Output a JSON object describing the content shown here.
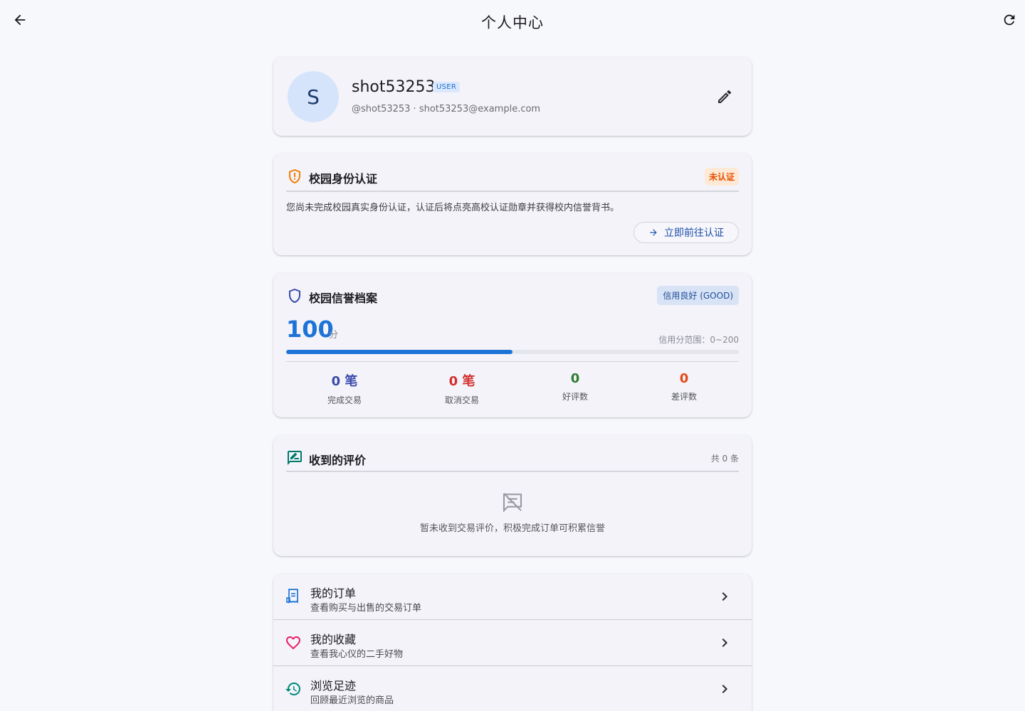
{
  "appbar": {
    "title": "个人中心",
    "back_icon": "arrow-left-icon",
    "refresh_icon": "refresh-icon"
  },
  "profile": {
    "avatar_initial": "S",
    "username": "shot53253",
    "role_badge": "USER",
    "handle_line": "@shot53253 · shot53253@example.com",
    "edit_icon": "pencil-icon",
    "avatar_color": "#d6e4fb"
  },
  "verification": {
    "title": "校园身份认证",
    "icon": "shield-alert-icon",
    "status": "未认证",
    "description": "您尚未完成校园真实身份认证，认证后将点亮高校认证勋章并获得校内信誉背书。",
    "action_label": "立即前往认证",
    "status_color": "#e65100"
  },
  "credit": {
    "title": "校园信誉档案",
    "icon": "shield-outline-icon",
    "level": "信用良好 (GOOD)",
    "score": "100",
    "score_unit": "分",
    "range_text": "信用分范围：0~200",
    "progress_fraction": 0.5,
    "accent_color": "#1e73d6",
    "stats": [
      {
        "value": "0 笔",
        "label": "完成交易",
        "color": "#3949ab"
      },
      {
        "value": "0 笔",
        "label": "取消交易",
        "color": "#d32f2f"
      },
      {
        "value": "0",
        "label": "好评数",
        "color": "#2e7d32"
      },
      {
        "value": "0",
        "label": "差评数",
        "color": "#e64a19"
      }
    ]
  },
  "reviews": {
    "title": "收到的评价",
    "icon": "rate-review-icon",
    "count_text": "共 0 条",
    "empty_icon": "comments-disabled-icon",
    "empty_text": "暂未收到交易评价，积极完成订单可积累信誉"
  },
  "menu": [
    {
      "title": "我的订单",
      "subtitle": "查看购买与出售的交易订单",
      "icon": "receipt-icon",
      "color": "#1e73d6"
    },
    {
      "title": "我的收藏",
      "subtitle": "查看我心仪的二手好物",
      "icon": "heart-icon",
      "color": "#e91e63"
    },
    {
      "title": "浏览足迹",
      "subtitle": "回顾最近浏览的商品",
      "icon": "history-icon",
      "color": "#00897b"
    }
  ]
}
